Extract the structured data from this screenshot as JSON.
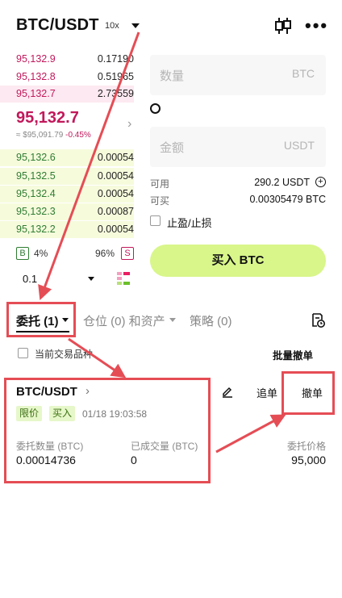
{
  "header": {
    "pair": "BTC/USDT",
    "leverage": "10x"
  },
  "orderbook": {
    "asks": [
      {
        "price": "95,132.9",
        "qty": "0.17190"
      },
      {
        "price": "95,132.8",
        "qty": "0.51965"
      },
      {
        "price": "95,132.7",
        "qty": "2.73559"
      }
    ],
    "last_price": "95,132.7",
    "index_price": "≈ $95,091.79",
    "change": "-0.45%",
    "bids": [
      {
        "price": "95,132.6",
        "qty": "0.00054"
      },
      {
        "price": "95,132.5",
        "qty": "0.00054"
      },
      {
        "price": "95,132.4",
        "qty": "0.00054"
      },
      {
        "price": "95,132.3",
        "qty": "0.00087"
      },
      {
        "price": "95,132.2",
        "qty": "0.00054"
      }
    ],
    "buy_ratio_label": "B",
    "buy_ratio": "4%",
    "sell_ratio": "96%",
    "sell_ratio_label": "S",
    "precision": "0.1"
  },
  "trade": {
    "quantity_placeholder": "数量",
    "quantity_unit": "BTC",
    "amount_placeholder": "金额",
    "amount_unit": "USDT",
    "available_label": "可用",
    "available_value": "290.2 USDT",
    "can_buy_label": "可买",
    "can_buy_value": "0.00305479 BTC",
    "tpsl_label": "止盈/止损",
    "buy_button": "买入 BTC"
  },
  "tabs": {
    "orders": "委托 (1)",
    "positions": "仓位 (0) 和资产",
    "strategy": "策略 (0)"
  },
  "filter": {
    "current_pair_only": "当前交易品种",
    "batch_cancel": "批量撤单"
  },
  "order": {
    "pair": "BTC/USDT",
    "type_tag": "限价",
    "side_tag": "买入",
    "time": "01/18 19:03:58",
    "chase_button": "追单",
    "cancel_button": "撤单",
    "qty_label": "委托数量 (BTC)",
    "qty_value": "0.00014736",
    "filled_label": "已成交量 (BTC)",
    "filled_value": "0",
    "price_label": "委托价格",
    "price_value": "95,000"
  },
  "colors": {
    "accent_buy": "#d8f68a",
    "ask": "#c2185b",
    "bid": "#2e7d32",
    "annotation": "#e54d55"
  }
}
